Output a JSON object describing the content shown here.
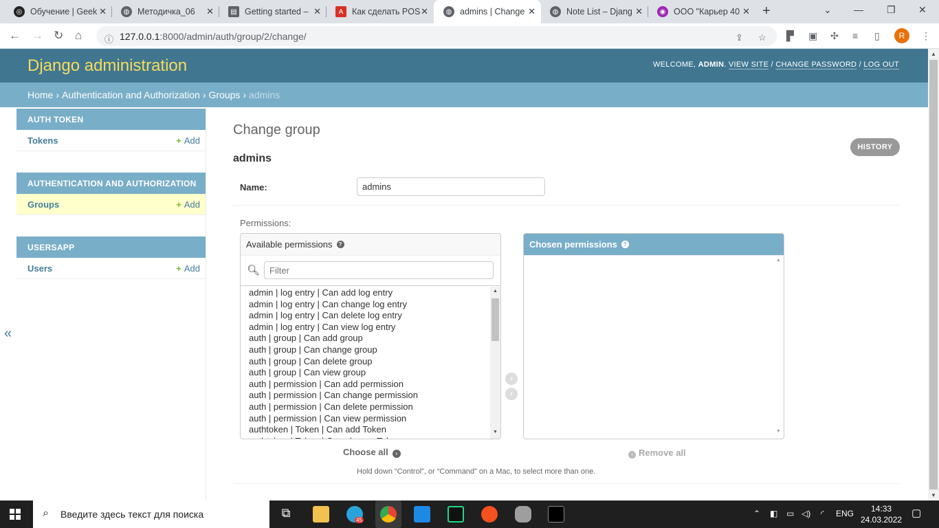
{
  "browser": {
    "tabs": [
      {
        "title": "Обучение | Geek",
        "icon": "geekbrains-icon",
        "color": "#222"
      },
      {
        "title": "Методичка_06",
        "icon": "globe-icon",
        "color": "#5f6368"
      },
      {
        "title": "Getting started –",
        "icon": "doc-icon",
        "color": "#5f6368"
      },
      {
        "title": "Как сделать POS",
        "icon": "habr-icon",
        "color": "#d93025"
      },
      {
        "title": "admins | Change",
        "icon": "globe-icon",
        "color": "#5f6368"
      },
      {
        "title": "Note List – Djang",
        "icon": "globe-icon",
        "color": "#5f6368"
      },
      {
        "title": "ООО \"Карьер 40",
        "icon": "podcast-icon",
        "color": "#9c27b0"
      }
    ],
    "url_host": "127.0.0.1",
    "url_path": ":8000/admin/auth/group/2/change/",
    "profile_initial": "R"
  },
  "header": {
    "brand": "Django administration",
    "welcome": "WELCOME, ",
    "user": "ADMIN",
    "view_site": "VIEW SITE",
    "change_password": "CHANGE PASSWORD",
    "log_out": "LOG OUT"
  },
  "breadcrumbs": {
    "home": "Home",
    "app": "Authentication and Authorization",
    "model": "Groups",
    "current": "admins"
  },
  "sidebar": {
    "apps": [
      {
        "caption": "Auth Token",
        "models": [
          {
            "name": "Tokens",
            "add": "Add"
          }
        ]
      },
      {
        "caption": "Authentication and Authorization",
        "models": [
          {
            "name": "Groups",
            "add": "Add"
          }
        ]
      },
      {
        "caption": "Usersapp",
        "models": [
          {
            "name": "Users",
            "add": "Add"
          }
        ]
      }
    ],
    "collapse": "«"
  },
  "content": {
    "title": "Change group",
    "object": "admins",
    "history": "HISTORY",
    "name_label": "Name:",
    "name_value": "admins",
    "permissions_label": "Permissions:",
    "available_caption": "Available permissions",
    "chosen_caption": "Chosen permissions",
    "filter_placeholder": "Filter",
    "available_options": [
      "admin | log entry | Can add log entry",
      "admin | log entry | Can change log entry",
      "admin | log entry | Can delete log entry",
      "admin | log entry | Can view log entry",
      "auth | group | Can add group",
      "auth | group | Can change group",
      "auth | group | Can delete group",
      "auth | group | Can view group",
      "auth | permission | Can add permission",
      "auth | permission | Can change permission",
      "auth | permission | Can delete permission",
      "auth | permission | Can view permission",
      "authtoken | Token | Can add Token",
      "authtoken | Token | Can change Token"
    ],
    "choose_all": "Choose all",
    "remove_all": "Remove all",
    "help": "Hold down “Control”, or “Command” on a Mac, to select more than one."
  },
  "taskbar": {
    "search_placeholder": "Введите здесь текст для поиска",
    "language": "ENG",
    "time": "14:33",
    "date": "24.03.2022",
    "telegram_badge": "45"
  }
}
